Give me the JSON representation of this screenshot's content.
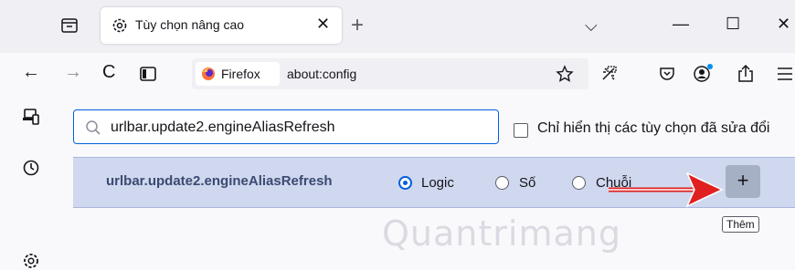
{
  "tab": {
    "title": "Tùy chọn nâng cao",
    "close": "✕",
    "new_tab": "+"
  },
  "window": {
    "dropdown": "⌵",
    "minimize": "—",
    "maximize": "☐",
    "close": "✕"
  },
  "nav": {
    "back": "←",
    "forward": "→",
    "reload": "C"
  },
  "urlbar": {
    "identity_label": "Firefox",
    "url": "about:config"
  },
  "config": {
    "search_value": "urlbar.update2.engineAliasRefresh",
    "show_modified_label": "Chỉ hiển thị các tùy chọn đã sửa đổi",
    "pref_name": "urlbar.update2.engineAliasRefresh",
    "types": [
      {
        "label": "Logic",
        "selected": true
      },
      {
        "label": "Số",
        "selected": false
      },
      {
        "label": "Chuỗi",
        "selected": false
      }
    ],
    "add_button": "+",
    "add_tooltip": "Thêm"
  },
  "watermark": "Quantrimang",
  "colors": {
    "accent": "#0060df",
    "row_bg": "#cfd8ee",
    "arrow": "#e02020"
  },
  "icons": [
    "tab-overview-icon",
    "settings-gear-icon",
    "search-icon",
    "firefox-logo-icon",
    "star-icon",
    "extensions-icon",
    "pocket-icon",
    "account-icon",
    "share-icon",
    "menu-icon",
    "synced-tabs-icon",
    "history-icon"
  ]
}
